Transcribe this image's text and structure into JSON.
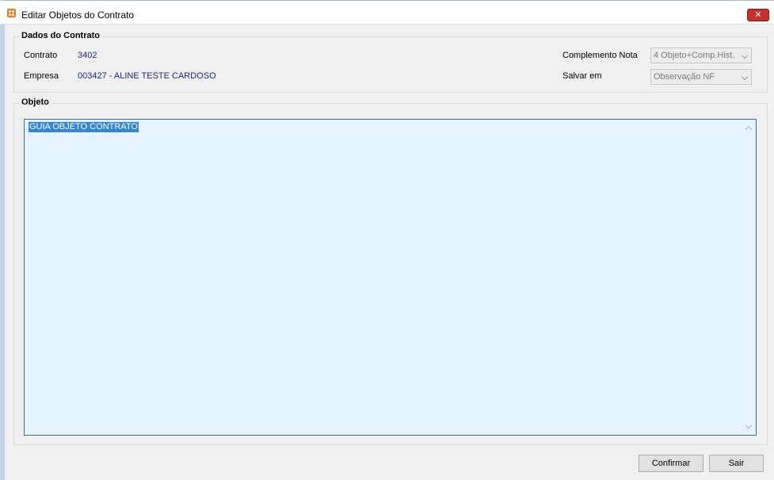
{
  "window": {
    "title": "Editar Objetos do Contrato",
    "close_label": "✕"
  },
  "dados": {
    "legend": "Dados do Contrato",
    "contrato_label": "Contrato",
    "contrato_value": "3402",
    "empresa_label": "Empresa",
    "empresa_value": "003427 - ALINE TESTE CARDOSO",
    "complemento_label": "Complemento Nota",
    "complemento_value": "4 Objeto+Comp.Hist.",
    "salvar_label": "Salvar em",
    "salvar_value": "Observação NF"
  },
  "objeto": {
    "legend": "Objeto",
    "text": "GUIA OBJETO CONTRATO"
  },
  "buttons": {
    "confirm_label": "Confirmar",
    "exit_label": "Sair"
  },
  "colors": {
    "value_text": "#1f1f8a",
    "selection": "#3386d5",
    "textarea_bg": "#e6f3ff",
    "close_button": "#c7302a"
  },
  "icons": {
    "app": "app-icon",
    "close": "close-icon",
    "combo_arrow": "chevron-down-icon",
    "scroll_up": "chevron-up-icon",
    "scroll_down": "chevron-down-icon"
  }
}
